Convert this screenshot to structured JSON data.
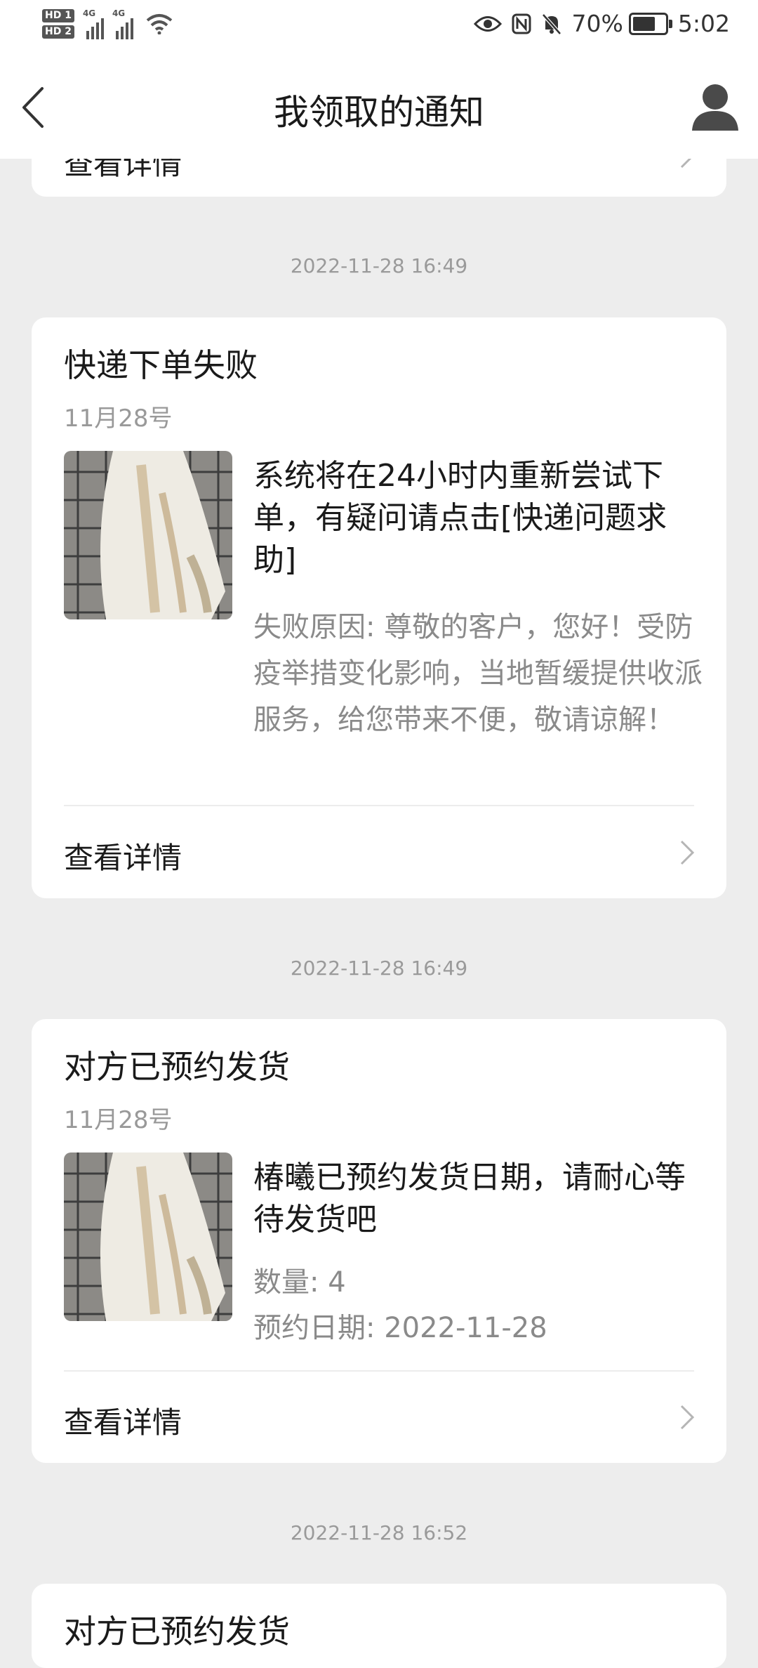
{
  "status_bar": {
    "sim1": "HD 1",
    "sim2": "HD 2",
    "net1": "4G",
    "net2": "4G",
    "battery_percent": "70%",
    "battery_level": 0.7,
    "time": "5:02"
  },
  "header": {
    "title": "我领取的通知"
  },
  "top_card": {
    "detail_label": "查看详情"
  },
  "notifications": [
    {
      "timestamp": "2022-11-28 16:49",
      "title": "快递下单失败",
      "date": "11月28号",
      "message": "系统将在24小时内重新尝试下单，有疑问请点击[快递问题求助]",
      "sub_lines": [
        "失败原因: 尊敬的客户，您好！受防疫举措变化影响，当地暂缓提供收派服务，给您带来不便，敬请谅解！"
      ],
      "detail_label": "查看详情"
    },
    {
      "timestamp": "2022-11-28 16:49",
      "title": "对方已预约发货",
      "date": "11月28号",
      "message": "椿曦已预约发货日期，请耐心等待发货吧",
      "sub_lines": [
        "数量: 4",
        "预约日期: 2022-11-28"
      ],
      "detail_label": "查看详情"
    },
    {
      "timestamp": "2022-11-28 16:52",
      "title": "对方已预约发货"
    }
  ]
}
